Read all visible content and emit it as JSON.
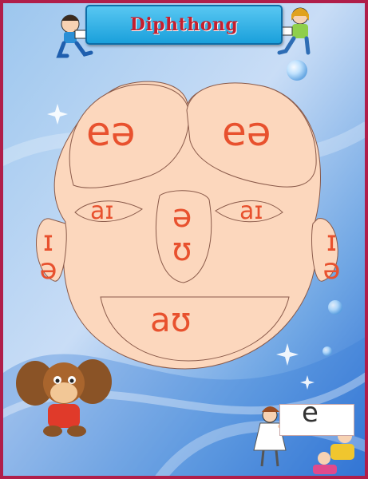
{
  "title": "Diphthong",
  "cells": {
    "forehead_left": "eə",
    "forehead_right": "eə",
    "eye_left": "aɪ",
    "eye_right": "aɪ",
    "nose": "əʊ",
    "ear_left": "ɪə",
    "ear_right": "ɪə",
    "mouth": "aʊ"
  },
  "card_letter": "e",
  "colors": {
    "symbol": "#e8512e",
    "face": "#fcd7bd",
    "title_text": "#c41f2e",
    "title_box": "#1aa0db",
    "border": "#b01e4a"
  }
}
